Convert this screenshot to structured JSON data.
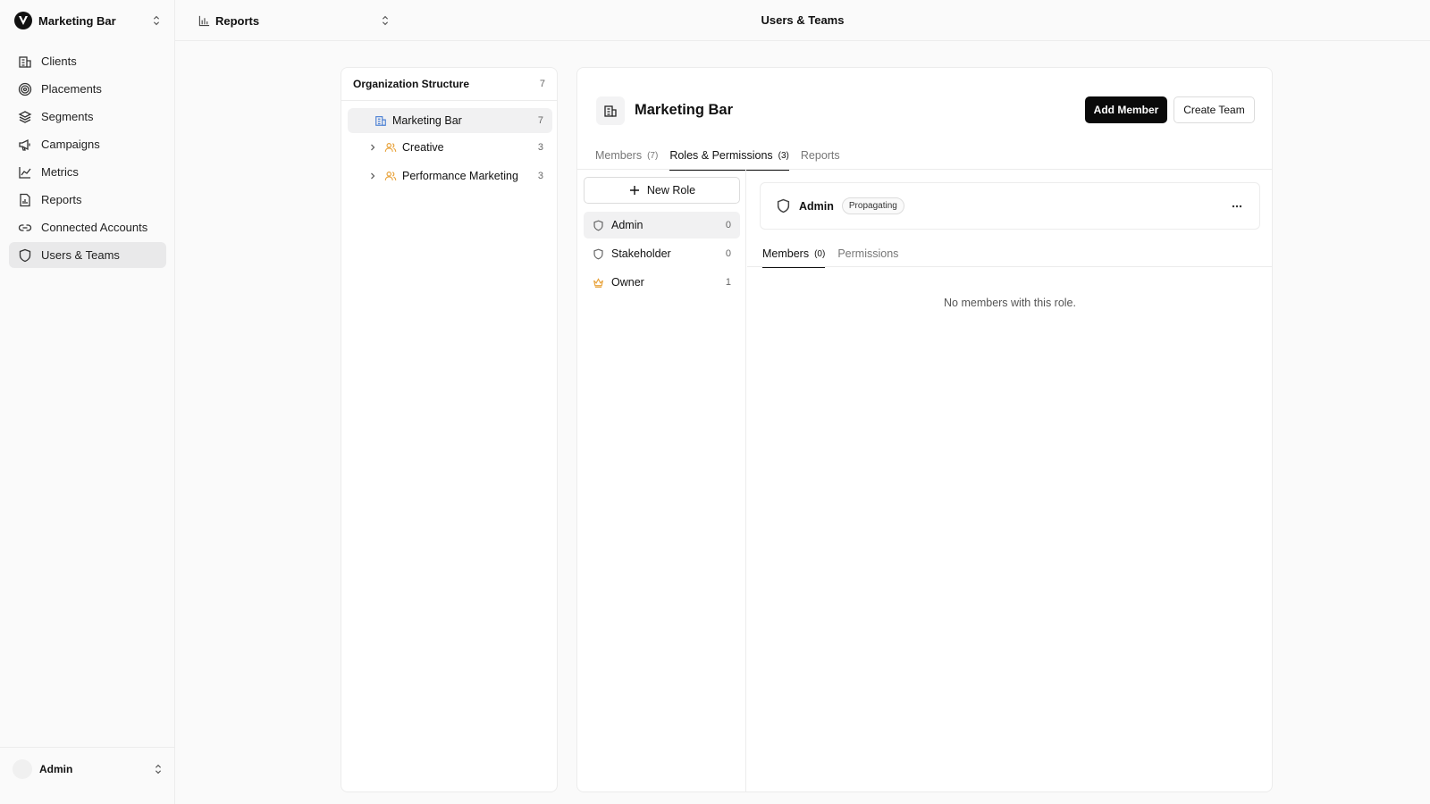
{
  "workspace": {
    "name": "Marketing Bar"
  },
  "sidebar": {
    "items": [
      {
        "label": "Clients",
        "icon": "building-icon"
      },
      {
        "label": "Placements",
        "icon": "target-icon"
      },
      {
        "label": "Segments",
        "icon": "layers-icon"
      },
      {
        "label": "Campaigns",
        "icon": "megaphone-icon"
      },
      {
        "label": "Metrics",
        "icon": "line-chart-icon"
      },
      {
        "label": "Reports",
        "icon": "report-icon"
      },
      {
        "label": "Connected Accounts",
        "icon": "link-icon"
      },
      {
        "label": "Users & Teams",
        "icon": "shield-icon",
        "active": true
      }
    ],
    "user": {
      "name": "Admin"
    }
  },
  "topbar": {
    "report_switch": "Reports",
    "title": "Users & Teams"
  },
  "org": {
    "title": "Organization Structure",
    "count": "7",
    "root": {
      "label": "Marketing Bar",
      "count": "7"
    },
    "children": [
      {
        "label": "Creative",
        "count": "3"
      },
      {
        "label": "Performance Marketing",
        "count": "3"
      }
    ]
  },
  "main": {
    "title": "Marketing Bar",
    "add_member": "Add Member",
    "create_team": "Create Team",
    "tabs": [
      {
        "label": "Members",
        "count": "(7)"
      },
      {
        "label": "Roles & Permissions",
        "count": "(3)",
        "active": true
      },
      {
        "label": "Reports",
        "count": ""
      }
    ],
    "new_role": "New Role",
    "roles": [
      {
        "label": "Admin",
        "count": "0",
        "icon": "shield-icon",
        "active": true
      },
      {
        "label": "Stakeholder",
        "count": "0",
        "icon": "shield-icon"
      },
      {
        "label": "Owner",
        "count": "1",
        "icon": "crown-icon"
      }
    ],
    "selected_role": {
      "name": "Admin",
      "badge": "Propagating"
    },
    "subtabs": [
      {
        "label": "Members",
        "count": "(0)",
        "active": true
      },
      {
        "label": "Permissions",
        "count": ""
      }
    ],
    "empty_message": "No members with this role."
  },
  "colors": {
    "accent": "#0a0a0a",
    "team_icon": "#e8a23a",
    "root_icon": "#4a7fd4"
  }
}
